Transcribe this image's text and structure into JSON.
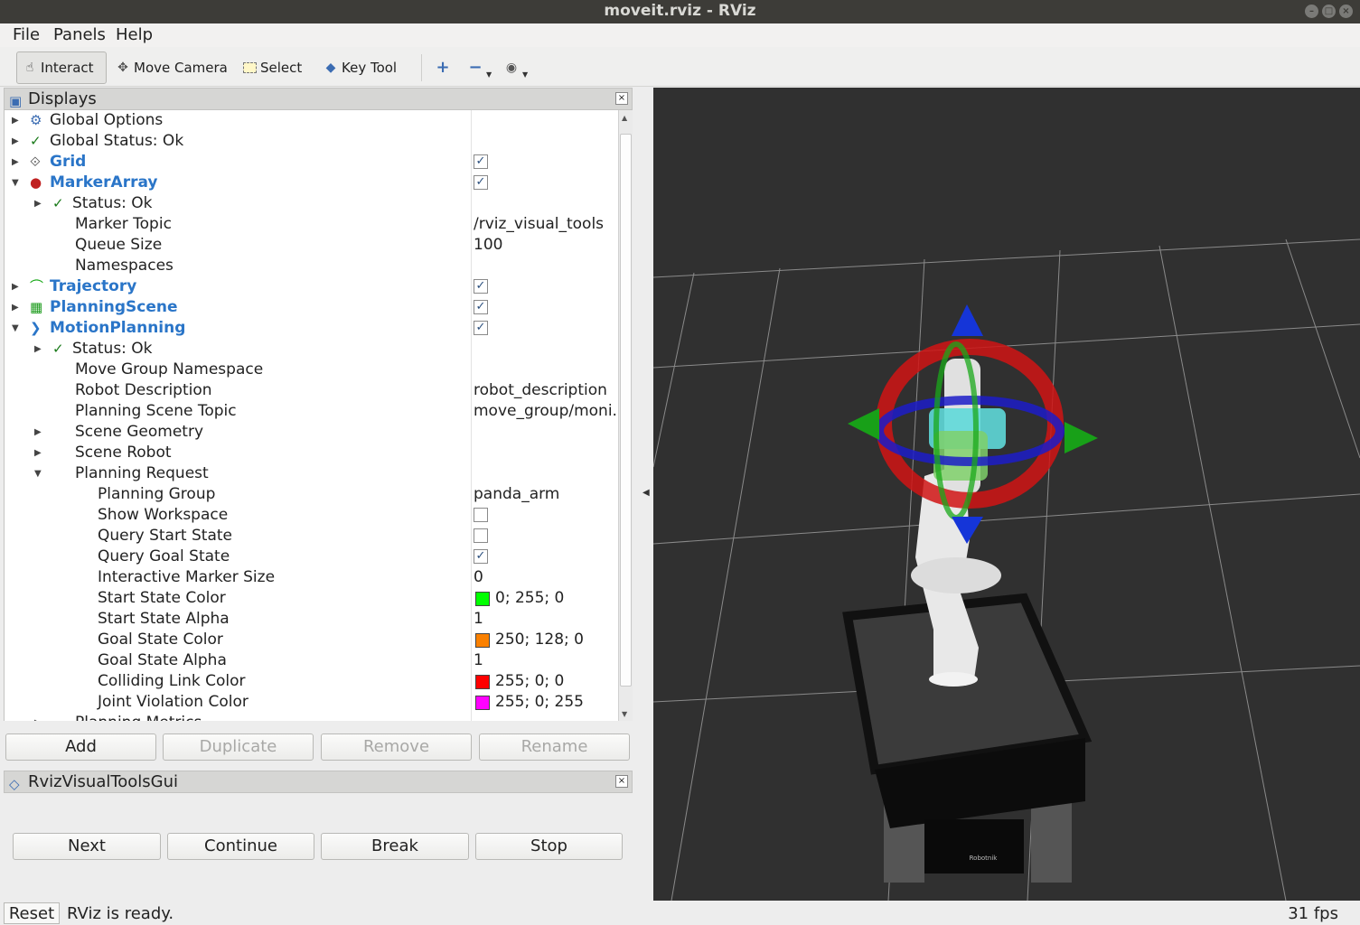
{
  "window": {
    "title": "moveit.rviz - RViz"
  },
  "menu": {
    "file": "File",
    "panels": "Panels",
    "help": "Help"
  },
  "toolbar": {
    "interact": "Interact",
    "move_camera": "Move Camera",
    "select": "Select",
    "key_tool": "Key Tool"
  },
  "displays": {
    "title": "Displays",
    "rows": [
      {
        "label": "Global Options",
        "icon": "gear-icon",
        "indent": 0,
        "arrow": "right"
      },
      {
        "label": "Global Status: Ok",
        "icon": "check-icon",
        "indent": 0,
        "arrow": "right"
      },
      {
        "label": "Grid",
        "icon": "grid-icon",
        "indent": 0,
        "arrow": "right",
        "blue": true,
        "checked": true
      },
      {
        "label": "MarkerArray",
        "icon": "marker-array-icon",
        "indent": 0,
        "arrow": "down",
        "blue": true,
        "checked": true
      },
      {
        "label": "Status: Ok",
        "icon": "check-icon",
        "indent": 1,
        "arrow": "right"
      },
      {
        "label": "Marker Topic",
        "indent": 1,
        "value": "/rviz_visual_tools"
      },
      {
        "label": "Queue Size",
        "indent": 1,
        "value": "100"
      },
      {
        "label": "Namespaces",
        "indent": 1
      },
      {
        "label": "Trajectory",
        "icon": "trajectory-icon",
        "indent": 0,
        "arrow": "right",
        "blue": true,
        "checked": true
      },
      {
        "label": "PlanningScene",
        "icon": "planning-scene-icon",
        "indent": 0,
        "arrow": "right",
        "blue": true,
        "checked": true
      },
      {
        "label": "MotionPlanning",
        "icon": "motion-planning-icon",
        "indent": 0,
        "arrow": "down",
        "blue": true,
        "checked": true
      },
      {
        "label": "Status: Ok",
        "icon": "check-icon",
        "indent": 1,
        "arrow": "right"
      },
      {
        "label": "Move Group Namespace",
        "indent": 1
      },
      {
        "label": "Robot Description",
        "indent": 1,
        "value": "robot_description"
      },
      {
        "label": "Planning Scene Topic",
        "indent": 1,
        "value": "move_group/moni..."
      },
      {
        "label": "Scene Geometry",
        "indent": 1,
        "arrow": "right"
      },
      {
        "label": "Scene Robot",
        "indent": 1,
        "arrow": "right"
      },
      {
        "label": "Planning Request",
        "indent": 1,
        "arrow": "down"
      },
      {
        "label": "Planning Group",
        "indent": 2,
        "value": "panda_arm"
      },
      {
        "label": "Show Workspace",
        "indent": 2,
        "checked": false
      },
      {
        "label": "Query Start State",
        "indent": 2,
        "checked": false
      },
      {
        "label": "Query Goal State",
        "indent": 2,
        "checked": true
      },
      {
        "label": "Interactive Marker Size",
        "indent": 2,
        "value": "0"
      },
      {
        "label": "Start State Color",
        "indent": 2,
        "color": "#00ff00",
        "value": "0; 255; 0"
      },
      {
        "label": "Start State Alpha",
        "indent": 2,
        "value": "1"
      },
      {
        "label": "Goal State Color",
        "indent": 2,
        "color": "#fa8000",
        "value": "250; 128; 0"
      },
      {
        "label": "Goal State Alpha",
        "indent": 2,
        "value": "1"
      },
      {
        "label": "Colliding Link Color",
        "indent": 2,
        "color": "#ff0000",
        "value": "255; 0; 0"
      },
      {
        "label": "Joint Violation Color",
        "indent": 2,
        "color": "#ff00ff",
        "value": "255; 0; 255"
      },
      {
        "label": "Planning Metrics",
        "indent": 1,
        "arrow": "right"
      }
    ],
    "buttons": {
      "add": "Add",
      "duplicate": "Duplicate",
      "remove": "Remove",
      "rename": "Rename"
    }
  },
  "rviz_visual_tools": {
    "title": "RvizVisualToolsGui",
    "next": "Next",
    "continue": "Continue",
    "break": "Break",
    "stop": "Stop"
  },
  "status": {
    "reset": "Reset",
    "message": "RViz is ready.",
    "fps": "31 fps"
  },
  "base_logo": "Robotnik"
}
